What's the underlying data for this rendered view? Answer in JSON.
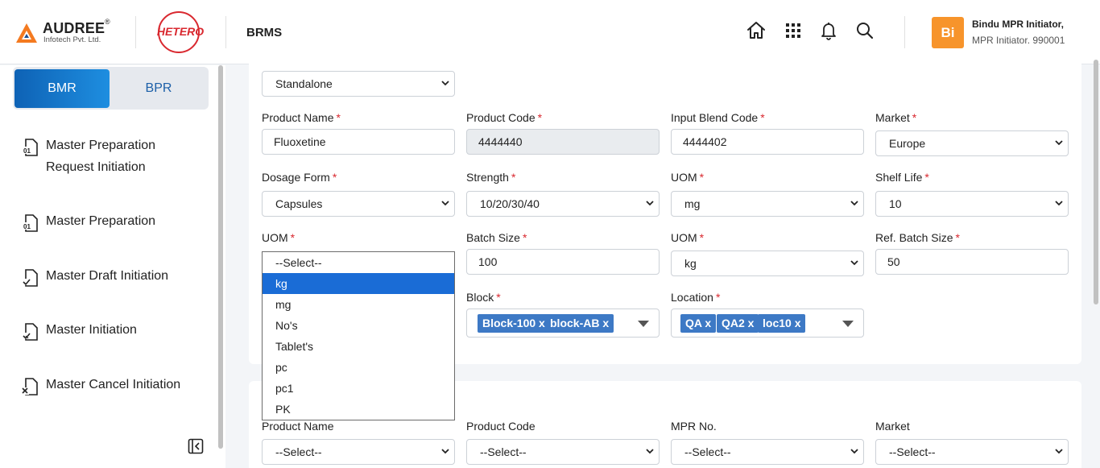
{
  "header": {
    "logo_name": "AUDREE",
    "logo_reg": "®",
    "logo_sub": "Infotech Pvt. Ltd.",
    "partner_logo": "HETERO",
    "app_name": "BRMS",
    "icons": [
      "home-icon",
      "apps-grid-icon",
      "bell-icon",
      "search-icon"
    ],
    "user": {
      "initials": "Bi",
      "name": "Bindu MPR Initiator,",
      "role": "MPR Initiator. 990001",
      "avatar_color": "#f7942b"
    }
  },
  "sidebar": {
    "toggle": {
      "active": "BMR",
      "inactive": "BPR"
    },
    "items": [
      {
        "label": "Master Preparation Request Initiation",
        "icon": "document-01-icon"
      },
      {
        "label": "Master Preparation",
        "icon": "document-01-icon"
      },
      {
        "label": "Master Draft Initiation",
        "icon": "document-check-icon"
      },
      {
        "label": "Master Initiation",
        "icon": "document-check-icon"
      },
      {
        "label": "Master Cancel Initiation",
        "icon": "document-cancel-icon"
      }
    ]
  },
  "form": {
    "type_select": "Standalone",
    "fields": {
      "product_name": {
        "label": "Product Name",
        "value": "Fluoxetine"
      },
      "product_code": {
        "label": "Product Code",
        "value": "4444440"
      },
      "input_blend_code": {
        "label": "Input Blend Code",
        "value": "4444402"
      },
      "market": {
        "label": "Market",
        "value": "Europe"
      },
      "dosage_form": {
        "label": "Dosage Form",
        "value": "Capsules"
      },
      "strength": {
        "label": "Strength",
        "value": "10/20/30/40"
      },
      "uom1": {
        "label": "UOM",
        "value": "mg"
      },
      "shelf_life": {
        "label": "Shelf Life",
        "value": "10"
      },
      "uom2": {
        "label": "UOM"
      },
      "batch_size": {
        "label": "Batch Size",
        "value": "100"
      },
      "uom3": {
        "label": "UOM",
        "value": "kg"
      },
      "ref_batch_size": {
        "label": "Ref. Batch Size",
        "value": "50"
      },
      "block": {
        "label": "Block",
        "tags": [
          "Block-100 x",
          "block-AB x"
        ]
      },
      "location": {
        "label": "Location",
        "tags": [
          "QA x",
          "QA2 x",
          "loc10 x"
        ]
      }
    },
    "required_mark": "*",
    "uom_dropdown": {
      "options": [
        "--Select--",
        "kg",
        "mg",
        "No's",
        "Tablet's",
        "pc",
        "pc1",
        "PK"
      ],
      "highlighted": "kg"
    }
  },
  "filter": {
    "product_name": {
      "label": "Product Name",
      "value": "--Select--"
    },
    "product_code": {
      "label": "Product Code",
      "value": "--Select--"
    },
    "mpr_no": {
      "label": "MPR No.",
      "value": "--Select--"
    },
    "market": {
      "label": "Market",
      "value": "--Select--"
    }
  }
}
